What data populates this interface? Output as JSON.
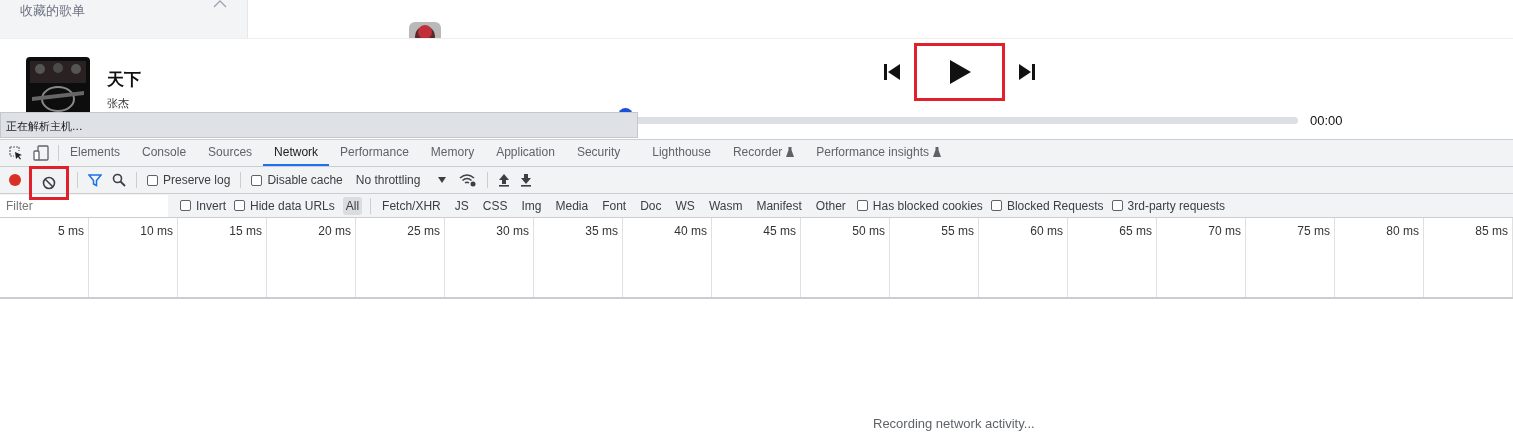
{
  "sidebar": {
    "section_title": "收藏的歌单",
    "expanded": true
  },
  "player": {
    "song_title": "天下",
    "artist": "张杰",
    "playing": false,
    "level": 0,
    "duration": "00:00"
  },
  "status_tooltip": "正在解析主机...",
  "devtools": {
    "tabs": [
      {
        "label": "Elements",
        "selected": false,
        "experimental": false
      },
      {
        "label": "Console",
        "selected": false,
        "experimental": false
      },
      {
        "label": "Sources",
        "selected": false,
        "experimental": false
      },
      {
        "label": "Network",
        "selected": true,
        "experimental": false
      },
      {
        "label": "Performance",
        "selected": false,
        "experimental": false
      },
      {
        "label": "Memory",
        "selected": false,
        "experimental": false
      },
      {
        "label": "Application",
        "selected": false,
        "experimental": false
      },
      {
        "label": "Security",
        "selected": false,
        "experimental": false
      },
      {
        "label": "Lighthouse",
        "selected": false,
        "experimental": false
      },
      {
        "label": "Recorder",
        "selected": false,
        "experimental": true
      },
      {
        "label": "Performance insights",
        "selected": false,
        "experimental": true
      }
    ],
    "toolbar": {
      "recording": true,
      "preserve_log": {
        "label": "Preserve log",
        "checked": false
      },
      "disable_cache": {
        "label": "Disable cache",
        "checked": false
      },
      "throttling": "No throttling"
    },
    "filter": {
      "placeholder": "Filter",
      "options": [
        {
          "label": "Invert",
          "checked": false
        },
        {
          "label": "Hide data URLs",
          "checked": false
        }
      ],
      "types": [
        {
          "label": "All",
          "selected": true
        },
        {
          "label": "Fetch/XHR",
          "selected": false
        },
        {
          "label": "JS",
          "selected": false
        },
        {
          "label": "CSS",
          "selected": false
        },
        {
          "label": "Img",
          "selected": false
        },
        {
          "label": "Media",
          "selected": false
        },
        {
          "label": "Font",
          "selected": false
        },
        {
          "label": "Doc",
          "selected": false
        },
        {
          "label": "WS",
          "selected": false
        },
        {
          "label": "Wasm",
          "selected": false
        },
        {
          "label": "Manifest",
          "selected": false
        },
        {
          "label": "Other",
          "selected": false
        }
      ],
      "extra_options": [
        {
          "label": "Has blocked cookies",
          "checked": false
        },
        {
          "label": "Blocked Requests",
          "checked": false
        },
        {
          "label": "3rd-party requests",
          "checked": false
        }
      ]
    },
    "timeline_ticks": [
      "5 ms",
      "10 ms",
      "15 ms",
      "20 ms",
      "25 ms",
      "30 ms",
      "35 ms",
      "40 ms",
      "45 ms",
      "50 ms",
      "55 ms",
      "60 ms",
      "65 ms",
      "70 ms",
      "75 ms",
      "80 ms",
      "85 ms"
    ],
    "empty_message": "Recording network activity..."
  }
}
